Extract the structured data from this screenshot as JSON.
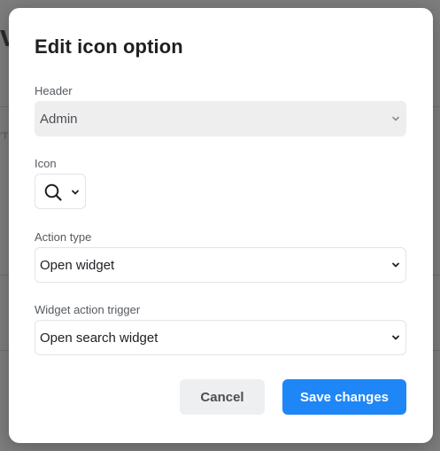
{
  "background": {
    "title_fragment": "va",
    "column_fragment": "ʻT"
  },
  "dialog": {
    "title": "Edit icon option",
    "header_field": {
      "label": "Header",
      "value": "Admin"
    },
    "icon_field": {
      "label": "Icon",
      "icon": "search-icon"
    },
    "action_type_field": {
      "label": "Action type",
      "value": "Open widget"
    },
    "widget_trigger_field": {
      "label": "Widget action trigger",
      "value": "Open search widget"
    },
    "buttons": {
      "cancel": "Cancel",
      "save": "Save changes"
    }
  },
  "colors": {
    "primary": "#1e86f7",
    "disabled_bg": "#eeeeee",
    "overlay": "#7d7d7d"
  }
}
